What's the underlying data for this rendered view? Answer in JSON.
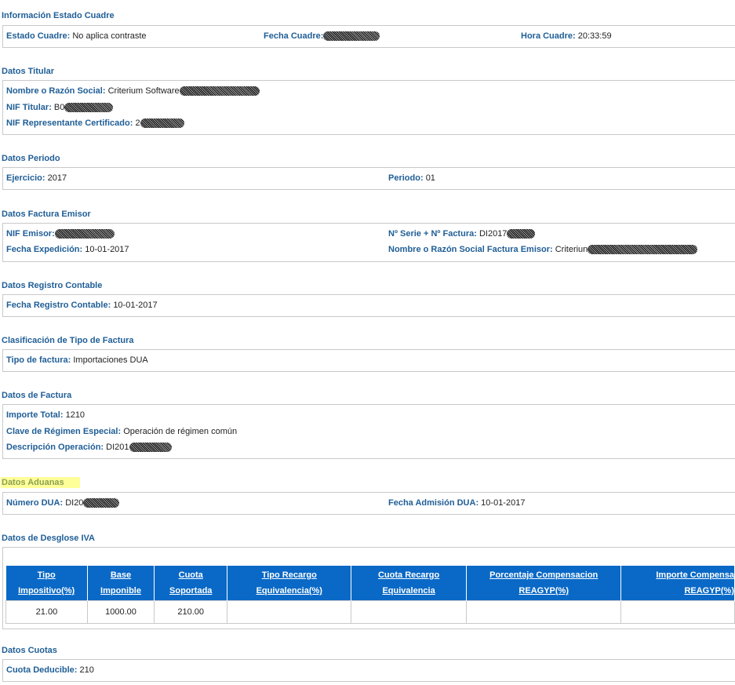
{
  "sections": {
    "estado": {
      "title": "Información Estado Cuadre",
      "estado_label": "Estado Cuadre:",
      "estado_value": "No aplica contraste",
      "fecha_label": "Fecha Cuadre:",
      "hora_label": "Hora Cuadre:",
      "hora_value": "20:33:59"
    },
    "titular": {
      "title": "Datos Titular",
      "nombre_label": "Nombre o Razón Social:",
      "nombre_value": "Criterium Software",
      "nif_label": "NIF Titular:",
      "nif_value": "B0",
      "rep_label": "NIF Representante Certificado:",
      "rep_value": "2"
    },
    "periodo": {
      "title": "Datos Periodo",
      "ejercicio_label": "Ejercicio:",
      "ejercicio_value": "2017",
      "periodo_label": "Periodo:",
      "periodo_value": "01"
    },
    "factura_emisor": {
      "title": "Datos Factura Emisor",
      "nif_label": "NIF Emisor:",
      "serie_label": "Nº Serie + Nº Factura:",
      "serie_value": "DI2017",
      "fecha_label": "Fecha Expedición:",
      "fecha_value": "10-01-2017",
      "nombre_label": "Nombre o Razón Social Factura Emisor:",
      "nombre_value": "Criteriun"
    },
    "registro": {
      "title": "Datos Registro Contable",
      "fecha_label": "Fecha Registro Contable:",
      "fecha_value": "10-01-2017"
    },
    "clasificacion": {
      "title": "Clasificación de Tipo de Factura",
      "tipo_label": "Tipo de factura:",
      "tipo_value": "Importaciones DUA"
    },
    "factura": {
      "title": "Datos de Factura",
      "importe_label": "Importe Total:",
      "importe_value": "1210",
      "clave_label": "Clave de Régimen Especial:",
      "clave_value": "Operación de régimen común",
      "desc_label": "Descripción Operación:",
      "desc_value": "DI201"
    },
    "aduanas": {
      "title": "Datos Aduanas",
      "dua_label": "Número DUA:",
      "dua_value": "DI20",
      "fecha_label": "Fecha Admisión DUA:",
      "fecha_value": "10-01-2017"
    },
    "desglose": {
      "title": "Datos de Desglose IVA",
      "headers": [
        [
          "Tipo",
          "Impositivo(%)"
        ],
        [
          "Base",
          "Imponible"
        ],
        [
          "Cuota",
          "Soportada"
        ],
        [
          "Tipo Recargo",
          "Equivalencia(%)"
        ],
        [
          "Cuota Recargo",
          "Equivalencia"
        ],
        [
          "Porcentaje Compensacion",
          "REAGYP(%)"
        ],
        [
          "Importe Compensa",
          "REAGYP(%)"
        ]
      ],
      "row": [
        "21.00",
        "1000.00",
        "210.00",
        "",
        "",
        "",
        ""
      ]
    },
    "cuotas": {
      "title": "Datos Cuotas",
      "deducible_label": "Cuota Deducible:",
      "deducible_value": "210"
    }
  },
  "colors": {
    "label": "#1f5e96",
    "table_header": "#0a69c6",
    "highlight": "#ffff9a"
  }
}
